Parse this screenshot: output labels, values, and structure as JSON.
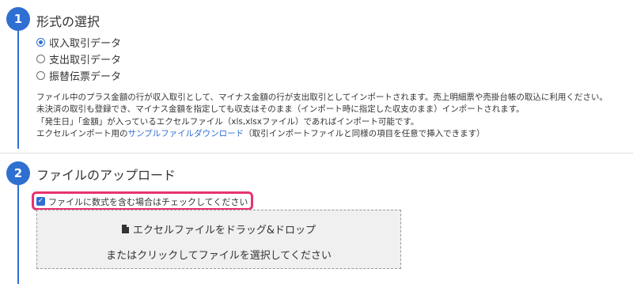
{
  "section1": {
    "number": "1",
    "title": "形式の選択",
    "options": [
      {
        "label": "収入取引データ",
        "checked": true
      },
      {
        "label": "支出取引データ",
        "checked": false
      },
      {
        "label": "振替伝票データ",
        "checked": false
      }
    ],
    "description": {
      "line1": "ファイル中のプラス金額の行が収入取引として、マイナス金額の行が支出取引としてインポートされます。売上明細票や売掛台帳の取込に利用ください。",
      "line2": "未決済の取引も登録でき、マイナス金額を指定しても収支はそのまま（インポート時に指定した収支のまま）インポートされます。",
      "line3": "「発生日」「金額」が入っているエクセルファイル（xls,xlsxファイル）であればインポート可能です。",
      "line4_prefix": "エクセルインポート用の",
      "line4_link": "サンプルファイルダウンロード",
      "line4_suffix": "（取引インポートファイルと同様の項目を任意で挿入できます）"
    }
  },
  "section2": {
    "number": "2",
    "title": "ファイルのアップロード",
    "checkbox_label": "ファイルに数式を含む場合はチェックしてください",
    "checkbox_checked": true,
    "dropzone_line1": "エクセルファイルをドラッグ&ドロップ",
    "dropzone_line2": "またはクリックしてファイルを選択してください",
    "dropzone_icon": "file-icon"
  },
  "colors": {
    "accent": "#2f6fd1",
    "highlight": "#e8336f",
    "dropzone_bg": "#f0f0f0"
  }
}
